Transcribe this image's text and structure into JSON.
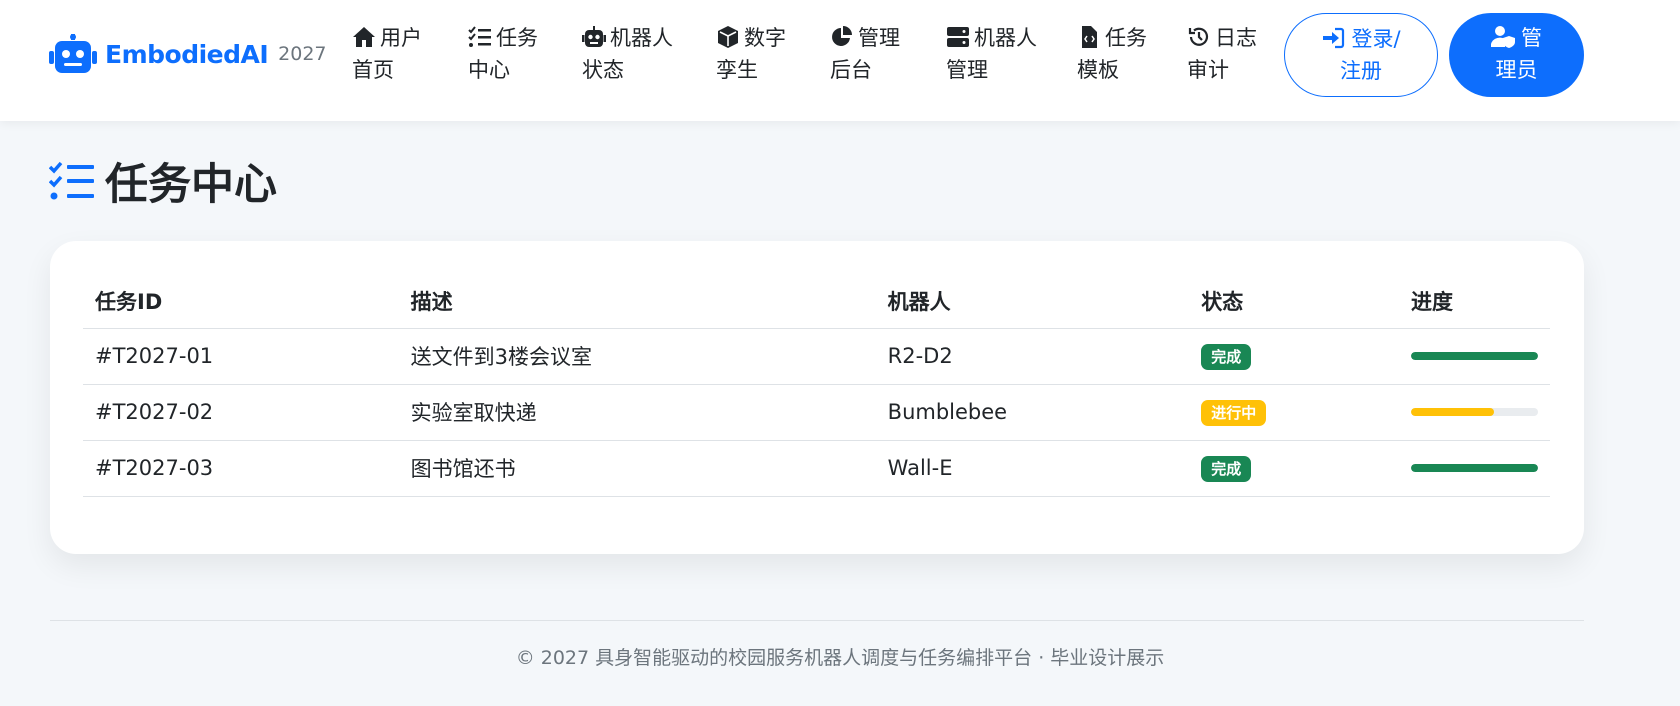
{
  "brand": {
    "name": "EmbodiedAI",
    "year": "2027",
    "color": "#0d6efd"
  },
  "nav": [
    {
      "icon": "home-icon",
      "line1": "用户",
      "line2": "首页"
    },
    {
      "icon": "list-check-icon",
      "line1": "任务",
      "line2": "中心"
    },
    {
      "icon": "robot-icon",
      "line1": "机器人",
      "line2": "状态"
    },
    {
      "icon": "cube-icon",
      "line1": "数字",
      "line2": "孪生"
    },
    {
      "icon": "chart-pie-icon",
      "line1": "管理",
      "line2": "后台"
    },
    {
      "icon": "server-icon",
      "line1": "机器人",
      "line2": "管理"
    },
    {
      "icon": "file-code-icon",
      "line1": "任务",
      "line2": "模板"
    },
    {
      "icon": "history-icon",
      "line1": "日志",
      "line2": "审计"
    }
  ],
  "auth": {
    "login_line1": "登录/",
    "login_line2": "注册",
    "admin_line1": "管",
    "admin_line2": "理员"
  },
  "page": {
    "title": "任务中心",
    "icon": "list-check-icon"
  },
  "table": {
    "headers": [
      "任务ID",
      "描述",
      "机器人",
      "状态",
      "进度"
    ],
    "rows": [
      {
        "id": "#T2027-01",
        "desc": "送文件到3楼会议室",
        "robot": "R2-D2",
        "status": "完成",
        "status_color": "#198754",
        "progress": 100,
        "progress_color": "#198754"
      },
      {
        "id": "#T2027-02",
        "desc": "实验室取快递",
        "robot": "Bumblebee",
        "status": "进行中",
        "status_color": "#ffc107",
        "progress": 65,
        "progress_color": "#ffc107"
      },
      {
        "id": "#T2027-03",
        "desc": "图书馆还书",
        "robot": "Wall-E",
        "status": "完成",
        "status_color": "#198754",
        "progress": 100,
        "progress_color": "#198754"
      }
    ]
  },
  "footer": {
    "text": "© 2027 具身智能驱动的校园服务机器人调度与任务编排平台 · 毕业设计展示"
  }
}
